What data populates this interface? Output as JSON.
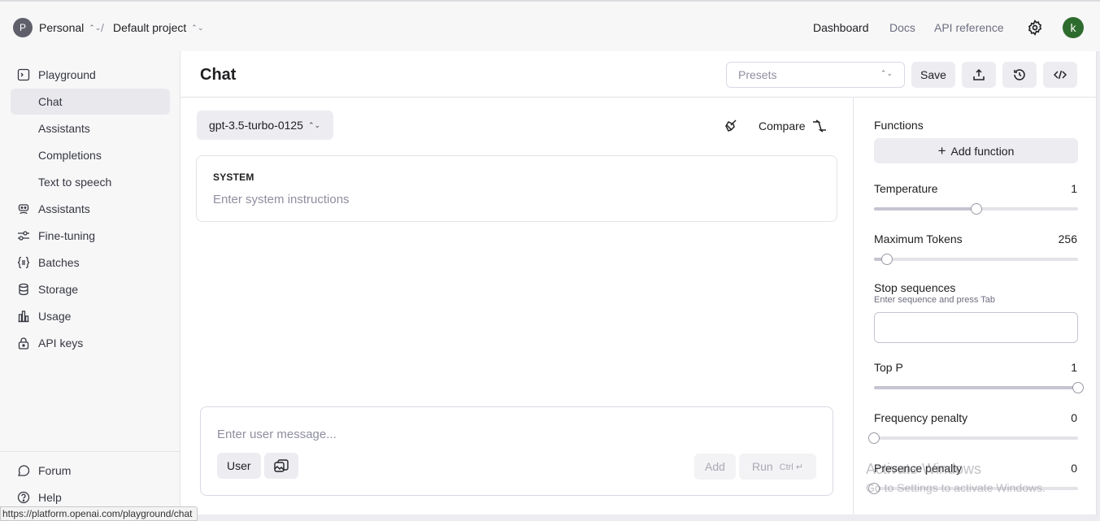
{
  "topbar": {
    "org_avatar": "P",
    "org_name": "Personal",
    "separator": "/",
    "project_name": "Default project",
    "nav": [
      "Dashboard",
      "Docs",
      "API reference"
    ],
    "settings_icon": "gear-icon",
    "user_avatar": "k"
  },
  "sidebar": {
    "items": [
      {
        "label": "Playground",
        "icon": "terminal-icon"
      },
      {
        "label": "Chat"
      },
      {
        "label": "Assistants"
      },
      {
        "label": "Completions"
      },
      {
        "label": "Text to speech"
      },
      {
        "label": "Assistants",
        "icon": "robot-icon"
      },
      {
        "label": "Fine-tuning",
        "icon": "sliders-icon"
      },
      {
        "label": "Batches",
        "icon": "braces-icon"
      },
      {
        "label": "Storage",
        "icon": "database-icon"
      },
      {
        "label": "Usage",
        "icon": "bar-chart-icon"
      },
      {
        "label": "API keys",
        "icon": "lock-icon"
      }
    ],
    "footer": [
      {
        "label": "Forum",
        "icon": "chat-bubble-icon"
      },
      {
        "label": "Help",
        "icon": "help-icon"
      }
    ]
  },
  "header": {
    "title": "Chat",
    "presets_placeholder": "Presets",
    "save_label": "Save"
  },
  "chat": {
    "model": "gpt-3.5-turbo-0125",
    "compare_label": "Compare",
    "system_title": "SYSTEM",
    "system_placeholder": "Enter system instructions",
    "message_placeholder": "Enter user message...",
    "role_label": "User",
    "add_label": "Add",
    "run_label": "Run",
    "run_shortcut": "Ctrl ↵"
  },
  "settings": {
    "functions_label": "Functions",
    "add_function_label": "Add function",
    "temperature": {
      "label": "Temperature",
      "value": "1",
      "fraction": 0.5
    },
    "max_tokens": {
      "label": "Maximum Tokens",
      "value": "256",
      "fraction": 0.063
    },
    "stop_sequences": {
      "label": "Stop sequences",
      "hint": "Enter sequence and press Tab"
    },
    "top_p": {
      "label": "Top P",
      "value": "1",
      "fraction": 1.0
    },
    "frequency_penalty": {
      "label": "Frequency penalty",
      "value": "0",
      "fraction": 0.0
    },
    "presence_penalty": {
      "label": "Presence penalty",
      "value": "0",
      "fraction": 0.0
    }
  },
  "watermark": {
    "line1": "Activate Windows",
    "line2": "Go to Settings to activate Windows."
  },
  "status_url": "https://platform.openai.com/playground/chat",
  "colors": {
    "accent_avatar": "#2e6b2e",
    "active_item_bg": "#e8e8ed"
  }
}
